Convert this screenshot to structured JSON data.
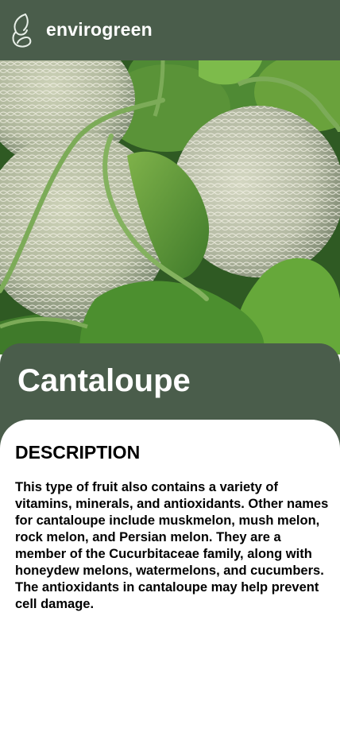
{
  "header": {
    "brand": "envirogreen",
    "logo_icon": "leaf-g-logo-icon"
  },
  "hero": {
    "image_subject": "cantaloupe-photo"
  },
  "product": {
    "title": "Cantaloupe"
  },
  "description": {
    "heading": "DESCRIPTION",
    "body": "This type of fruit also contains a variety of vitamins, minerals, and antioxidants. Other names for cantaloupe include muskmelon, mush melon, rock melon, and Persian melon. They are a member of the Cucurbitaceae family, along with honeydew melons, watermelons, and cucumbers. The antioxidants in cantaloupe may help prevent cell damage."
  },
  "colors": {
    "brand_green": "#4a5d4b",
    "text": "#000000",
    "background": "#ffffff"
  }
}
